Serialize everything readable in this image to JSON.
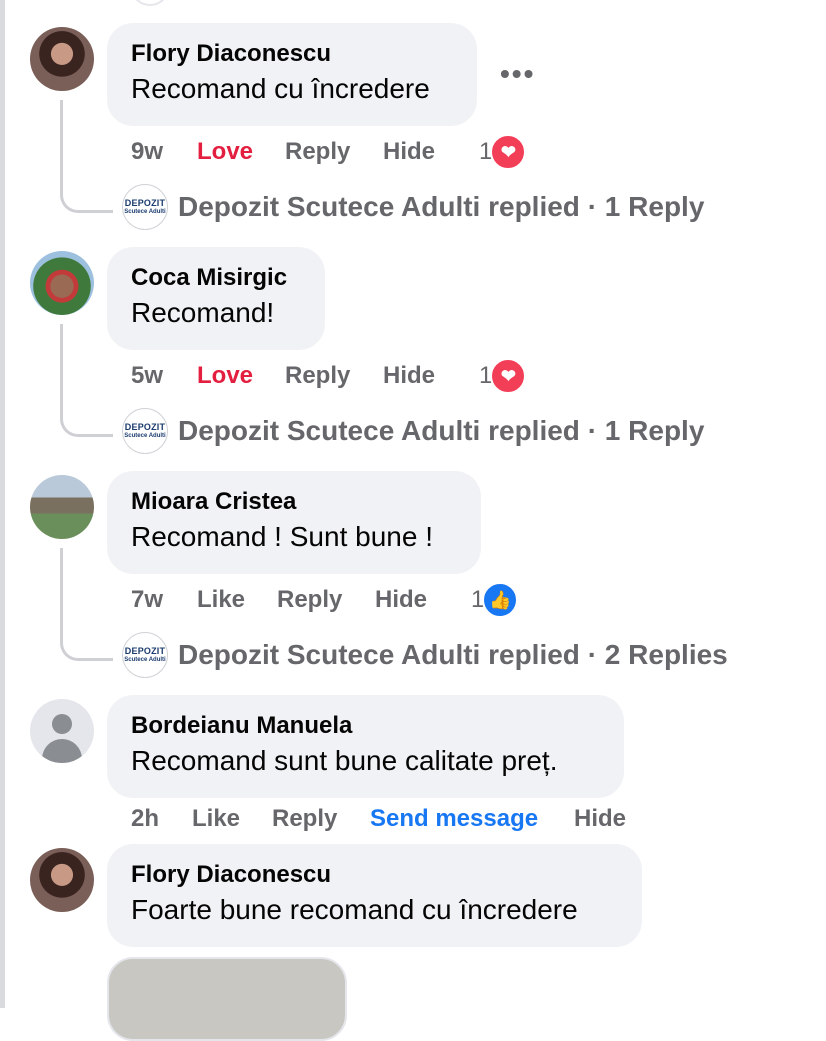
{
  "comments": [
    {
      "author": "Flory Diaconescu",
      "text": "Recomand cu încredere",
      "time": "9w",
      "reaction_label": "Love",
      "reply_label": "Reply",
      "hide_label": "Hide",
      "reaction_count": "1",
      "reaction_icon": "heart-icon",
      "replies": {
        "page": "Depozit Scutece Adulti",
        "text": "Depozit Scutece Adulti replied · 1 Reply"
      }
    },
    {
      "author": "Coca Misirgic",
      "text": "Recomand!",
      "time": "5w",
      "reaction_label": "Love",
      "reply_label": "Reply",
      "hide_label": "Hide",
      "reaction_count": "1",
      "reaction_icon": "heart-icon",
      "replies": {
        "page": "Depozit Scutece Adulti",
        "text": "Depozit Scutece Adulti replied · 1 Reply"
      }
    },
    {
      "author": "Mioara Cristea",
      "text": "Recomand ! Sunt bune !",
      "time": "7w",
      "reaction_label": "Like",
      "reply_label": "Reply",
      "hide_label": "Hide",
      "reaction_count": "1",
      "reaction_icon": "thumbs-up-icon",
      "replies": {
        "page": "Depozit Scutece Adulti",
        "text": "Depozit Scutece Adulti replied · 2 Replies"
      }
    },
    {
      "author": "Bordeianu Manuela",
      "text": "Recomand sunt bune calitate preț.",
      "time": "2h",
      "reaction_label": "Like",
      "reply_label": "Reply",
      "send_label": "Send message",
      "hide_label": "Hide"
    },
    {
      "author": "Flory Diaconescu",
      "text": "Foarte bune recomand cu încredere"
    }
  ],
  "page_avatar": {
    "line1": "DEPOZIT",
    "line2": "Scutece Adulti"
  },
  "more_label": "•••",
  "colors": {
    "love": "#e41e3f",
    "link": "#1877f2",
    "bubble": "#f0f2f5",
    "meta": "#65676b"
  }
}
